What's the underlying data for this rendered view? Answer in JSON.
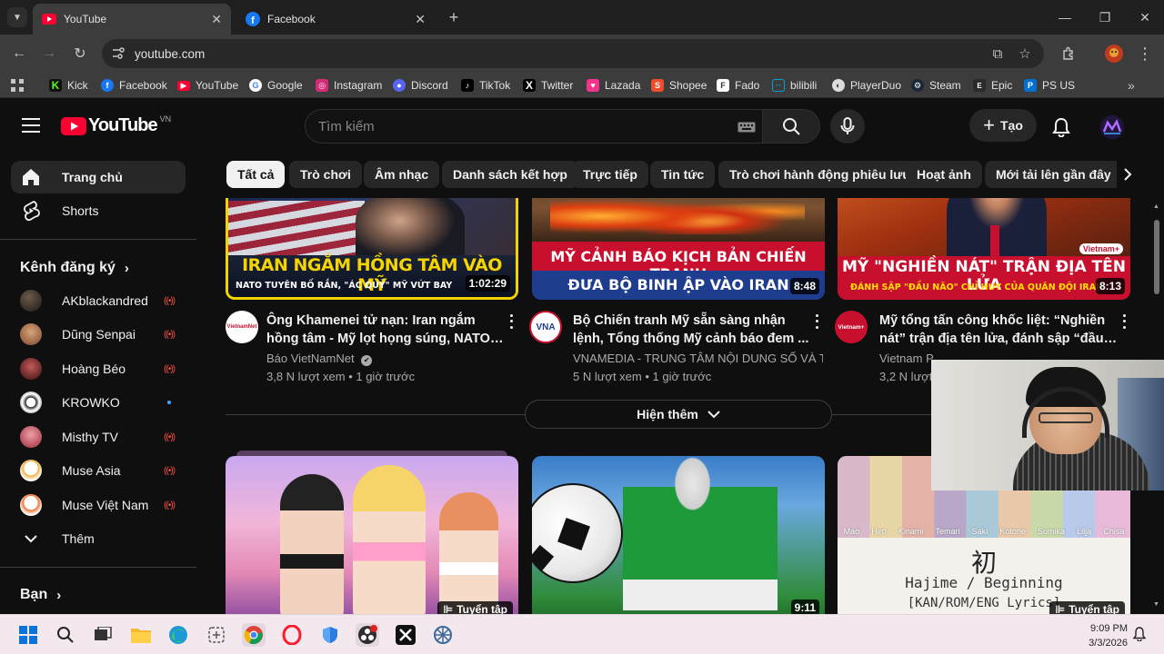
{
  "browser": {
    "tabs": [
      {
        "title": "YouTube",
        "active": true
      },
      {
        "title": "Facebook",
        "active": false
      }
    ],
    "url": "youtube.com",
    "bookmarks": [
      "Kick",
      "Facebook",
      "YouTube",
      "Google",
      "Instagram",
      "Discord",
      "TikTok",
      "Twitter",
      "Lazada",
      "Shopee",
      "Fado",
      "bilibili",
      "PlayerDuo",
      "Steam",
      "Epic",
      "PS US"
    ]
  },
  "youtube": {
    "logo_text": "YouTube",
    "region": "VN",
    "search_placeholder": "Tìm kiếm",
    "create_label": "Tạo",
    "sidebar": {
      "home": "Trang chủ",
      "shorts": "Shorts",
      "subscriptions_title": "Kênh đăng ký",
      "subscriptions": [
        {
          "name": "AKblackandred",
          "status": "live"
        },
        {
          "name": "Dũng Senpai",
          "status": "live"
        },
        {
          "name": "Hoàng Béo",
          "status": "live"
        },
        {
          "name": "KROWKO",
          "status": "new"
        },
        {
          "name": "Misthy TV",
          "status": "live"
        },
        {
          "name": "Muse Asia",
          "status": "live"
        },
        {
          "name": "Muse Việt Nam",
          "status": "live"
        }
      ],
      "more": "Thêm",
      "you_title": "Bạn"
    },
    "chips": [
      "Tất cả",
      "Trò chơi",
      "Âm nhạc",
      "Danh sách kết hợp",
      "Trực tiếp",
      "Tin tức",
      "Trò chơi hành động phiêu lưu",
      "Hoạt ảnh",
      "Mới tải lên gần đây"
    ],
    "videos_row1": [
      {
        "thumb_text": "IRAN NGẮM HỒNG TÂM VÀO MỸ",
        "thumb_sub": "NATO TUYÊN BỐ RẮN, \"ÁC QUỶ\" MỸ VỨT BAY",
        "duration": "1:02:29",
        "title": "Ông Khamenei tử nạn: Iran ngắm hồng tâm - Mỹ lọt họng súng, NATO ...",
        "channel": "Báo VietNamNet",
        "verified": "✔",
        "meta": "3,8 N lượt xem • 1 giờ trước",
        "avatar_text": "VietnamNet"
      },
      {
        "thumb_text": "MỸ CẢNH BÁO KỊCH BẢN CHIẾN TRANH",
        "thumb_sub": "ĐƯA BỘ BINH ẬP VÀO IRAN",
        "duration": "8:48",
        "title": "Bộ Chiến tranh Mỹ sẵn sàng nhận lệnh, Tổng thống Mỹ cảnh báo đem ...",
        "channel": "VNAMEDIA - TRUNG TÂM NỘI DUNG SỐ VÀ T...",
        "meta": "5 N lượt xem • 1 giờ trước",
        "avatar_text": "VNA"
      },
      {
        "thumb_text": "MỸ \"NGHIỀN NÁT\" TRẬN ĐỊA TÊN LỬA",
        "thumb_sub": "ĐÁNH SẬP \"ĐẦU NÃO\" CHỈ HUY CỦA QUÂN ĐỘI IRAN",
        "duration": "8:13",
        "thumb_badge": "Vietnam+",
        "title": "Mỹ tổng tấn công khốc liệt: “Nghiền nát” trận địa tên lửa, đánh sập “đầu ...",
        "channel": "Vietnam Plus",
        "meta": "3,2 N lượt xem",
        "avatar_text": "Vietnam+"
      }
    ],
    "show_more": "Hiện thêm",
    "videos_row2": [
      {
        "badge": "Tuyển tập"
      },
      {
        "duration": "9:11"
      },
      {
        "badge": "Tuyển tập",
        "kanji": "初",
        "line1": "Hajime / Beginning",
        "line2": "[KAN/ROM/ENG Lyrics]",
        "names": [
          "Mao",
          "Hiro",
          "Kinami",
          "Temari",
          "Saki",
          "Kotone",
          "Sumika",
          "Lilja",
          "Chisa"
        ]
      }
    ]
  },
  "taskbar": {
    "time": "9:09 PM",
    "date": "3/3/2026"
  },
  "colors": {
    "yt_red": "#ff0033",
    "bg": "#0f0f0f",
    "chip_bg": "#272727",
    "live_red": "#ff4e45"
  }
}
